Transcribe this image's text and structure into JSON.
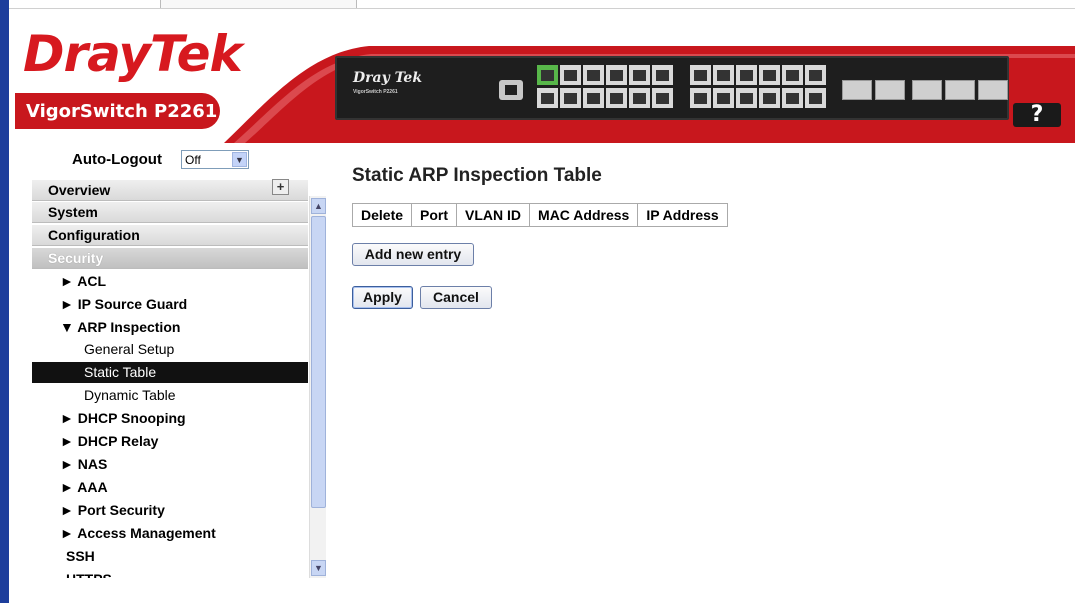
{
  "brand": {
    "logo": "DrayTek",
    "model": "VigorSwitch P2261",
    "device_logo": "Dray Tek",
    "device_model": "VigorSwitch P2261"
  },
  "help": {
    "label": "?"
  },
  "autologout": {
    "label": "Auto-Logout",
    "value": "Off"
  },
  "nav": {
    "overview": "Overview",
    "system": "System",
    "configuration": "Configuration",
    "security": "Security",
    "acl": "► ACL",
    "ip_source_guard": "► IP Source Guard",
    "arp_inspection": "▼ ARP Inspection",
    "general_setup": "General Setup",
    "static_table": "Static Table",
    "dynamic_table": "Dynamic Table",
    "dhcp_snooping": "► DHCP Snooping",
    "dhcp_relay": "► DHCP Relay",
    "nas": "► NAS",
    "aaa": "► AAA",
    "port_security": "► Port Security",
    "access_management": "► Access Management",
    "ssh": "SSH",
    "https": "HTTPS",
    "expand_icon": "plus-icon"
  },
  "main": {
    "title": "Static ARP Inspection Table",
    "columns": [
      "Delete",
      "Port",
      "VLAN ID",
      "MAC Address",
      "IP Address"
    ],
    "add_button": "Add new entry",
    "apply_button": "Apply",
    "cancel_button": "Cancel"
  },
  "colors": {
    "brand_red": "#c8171d",
    "frame_blue": "#1d3e9c",
    "port_active": "#58b74a"
  }
}
